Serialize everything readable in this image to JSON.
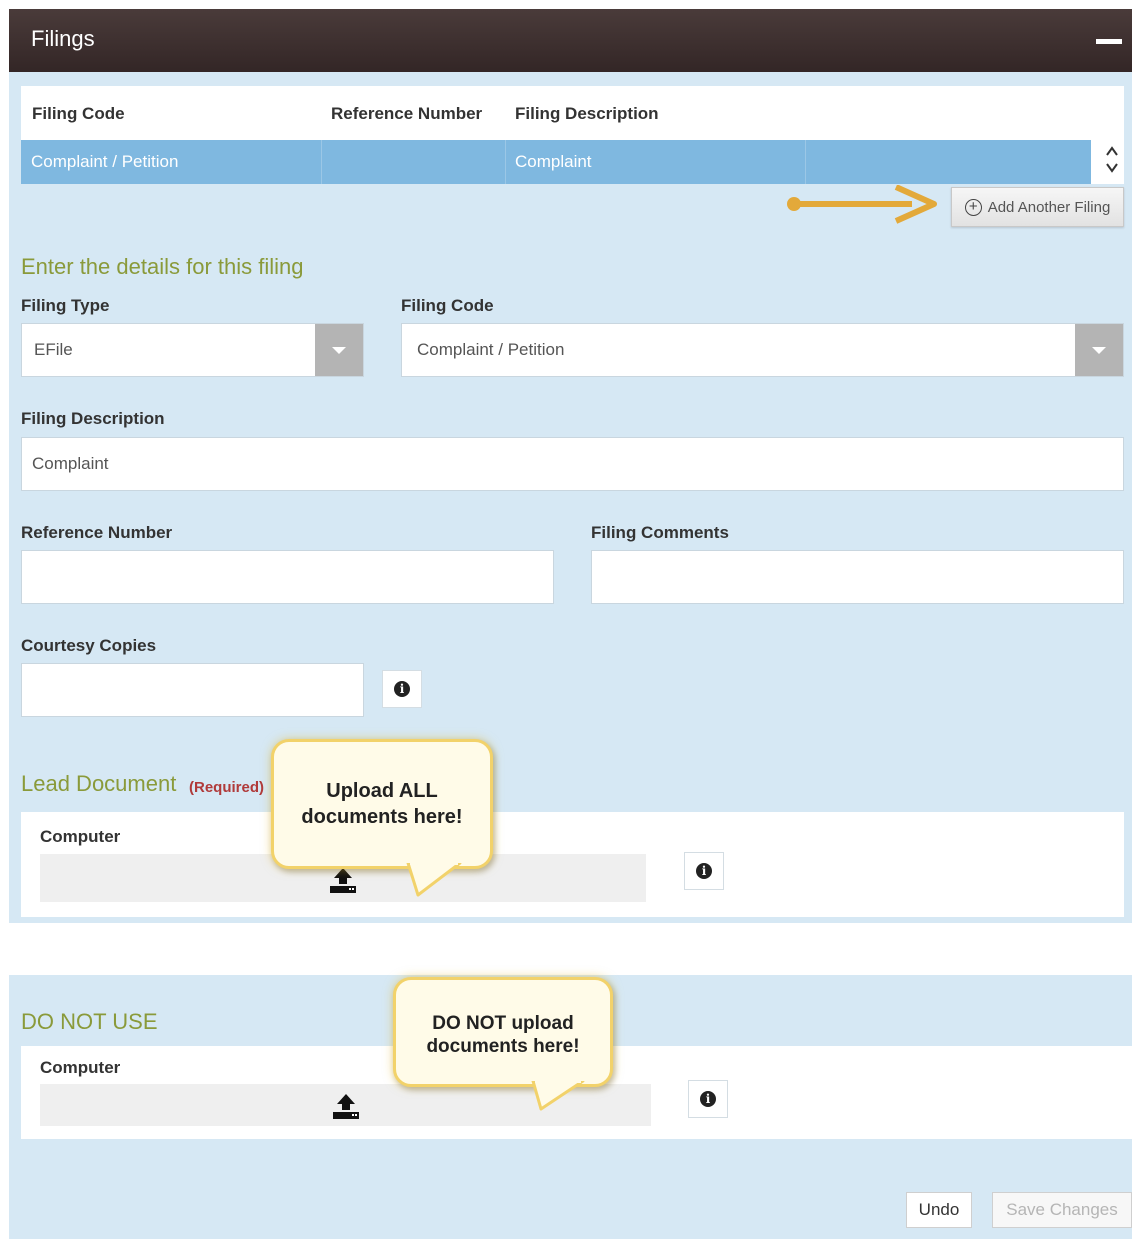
{
  "header": {
    "title": "Filings"
  },
  "table": {
    "columns": [
      "Filing Code",
      "Reference Number",
      "Filing Description"
    ],
    "rows": [
      {
        "filing_code": "Complaint / Petition",
        "reference_number": "",
        "filing_description": "Complaint"
      }
    ],
    "add_label": "Add Another Filing"
  },
  "details": {
    "heading": "Enter the details for this filing",
    "filing_type_label": "Filing Type",
    "filing_type_value": "EFile",
    "filing_code_label": "Filing Code",
    "filing_code_value": "Complaint / Petition",
    "filing_description_label": "Filing Description",
    "filing_description_value": "Complaint",
    "reference_number_label": "Reference Number",
    "reference_number_value": "",
    "filing_comments_label": "Filing Comments",
    "filing_comments_value": "",
    "courtesy_copies_label": "Courtesy Copies",
    "courtesy_copies_value": ""
  },
  "lead_document": {
    "heading": "Lead Document",
    "required": "(Required)",
    "source_label": "Computer",
    "callout": "Upload ALL documents here!"
  },
  "do_not_use": {
    "heading": "DO NOT USE",
    "source_label": "Computer",
    "callout": "DO NOT upload documents here!"
  },
  "actions": {
    "undo": "Undo",
    "save": "Save Changes"
  },
  "colors": {
    "header_bg": "#3d302f",
    "panel_bg": "#d6e8f4",
    "selected_row": "#7fb8e0",
    "heading_green": "#8a9a3a",
    "required_red": "#b03a3a",
    "annotation_arrow": "#e3a93a"
  }
}
